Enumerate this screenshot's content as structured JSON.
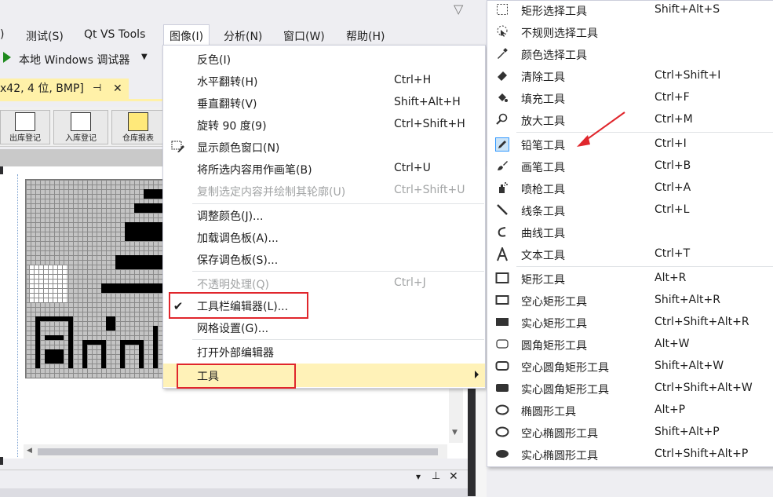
{
  "menubar": {
    "items": [
      {
        "label": ")"
      },
      {
        "label": "测试(S)"
      },
      {
        "label": "Qt VS Tools"
      },
      {
        "label": "图像(I)"
      },
      {
        "label": "分析(N)"
      },
      {
        "label": "窗口(W)"
      },
      {
        "label": "帮助(H)"
      }
    ]
  },
  "toolbar": {
    "debugger_label": "本地 Windows 调试器"
  },
  "document_tab": {
    "title": "x42, 4 位, BMP]"
  },
  "app_toolbar": {
    "buttons": [
      {
        "label": "出库登记"
      },
      {
        "label": "入库登记"
      },
      {
        "label": "仓库报表"
      }
    ]
  },
  "image_menu": {
    "items": [
      {
        "label": "反色(I)",
        "shortcut": ""
      },
      {
        "label": "水平翻转(H)",
        "shortcut": "Ctrl+H"
      },
      {
        "label": "垂直翻转(V)",
        "shortcut": "Shift+Alt+H"
      },
      {
        "label": "旋转 90 度(9)",
        "shortcut": "Ctrl+Shift+H"
      },
      {
        "label": "显示颜色窗口(N)",
        "shortcut": ""
      },
      {
        "label": "将所选内容用作画笔(B)",
        "shortcut": "Ctrl+U"
      },
      {
        "label": "复制选定内容并绘制其轮廓(U)",
        "shortcut": "Ctrl+Shift+U"
      },
      {
        "label": "调整颜色(J)...",
        "shortcut": ""
      },
      {
        "label": "加载调色板(A)...",
        "shortcut": ""
      },
      {
        "label": "保存调色板(S)...",
        "shortcut": ""
      },
      {
        "label": "不透明处理(Q)",
        "shortcut": "Ctrl+J"
      },
      {
        "label": "工具栏编辑器(L)...",
        "shortcut": ""
      },
      {
        "label": "网格设置(G)...",
        "shortcut": ""
      },
      {
        "label": "打开外部编辑器",
        "shortcut": ""
      },
      {
        "label": "工具",
        "shortcut": ""
      }
    ]
  },
  "tools_menu": {
    "items": [
      {
        "label": "矩形选择工具",
        "shortcut": "Shift+Alt+S",
        "icon": "dashed-rect-icon"
      },
      {
        "label": "不规则选择工具",
        "shortcut": "",
        "icon": "lasso-icon"
      },
      {
        "label": "颜色选择工具",
        "shortcut": "",
        "icon": "eyedropper-icon"
      },
      {
        "label": "清除工具",
        "shortcut": "Ctrl+Shift+I",
        "icon": "eraser-icon"
      },
      {
        "label": "填充工具",
        "shortcut": "Ctrl+F",
        "icon": "fill-bucket-icon"
      },
      {
        "label": "放大工具",
        "shortcut": "Ctrl+M",
        "icon": "magnifier-icon"
      },
      {
        "label": "铅笔工具",
        "shortcut": "Ctrl+I",
        "icon": "pencil-icon"
      },
      {
        "label": "画笔工具",
        "shortcut": "Ctrl+B",
        "icon": "brush-icon"
      },
      {
        "label": "喷枪工具",
        "shortcut": "Ctrl+A",
        "icon": "airbrush-icon"
      },
      {
        "label": "线条工具",
        "shortcut": "Ctrl+L",
        "icon": "line-icon"
      },
      {
        "label": "曲线工具",
        "shortcut": "",
        "icon": "curve-icon"
      },
      {
        "label": "文本工具",
        "shortcut": "Ctrl+T",
        "icon": "text-icon"
      },
      {
        "label": "矩形工具",
        "shortcut": "Alt+R",
        "icon": "rectangle-icon"
      },
      {
        "label": "空心矩形工具",
        "shortcut": "Shift+Alt+R",
        "icon": "hollow-rectangle-icon"
      },
      {
        "label": "实心矩形工具",
        "shortcut": "Ctrl+Shift+Alt+R",
        "icon": "filled-rectangle-icon"
      },
      {
        "label": "圆角矩形工具",
        "shortcut": "Alt+W",
        "icon": "rounded-rectangle-icon"
      },
      {
        "label": "空心圆角矩形工具",
        "shortcut": "Shift+Alt+W",
        "icon": "hollow-rounded-rectangle-icon"
      },
      {
        "label": "实心圆角矩形工具",
        "shortcut": "Ctrl+Shift+Alt+W",
        "icon": "filled-rounded-rectangle-icon"
      },
      {
        "label": "椭圆形工具",
        "shortcut": "Alt+P",
        "icon": "ellipse-icon"
      },
      {
        "label": "空心椭圆形工具",
        "shortcut": "Shift+Alt+P",
        "icon": "hollow-ellipse-icon"
      },
      {
        "label": "实心椭圆形工具",
        "shortcut": "Ctrl+Shift+Alt+P",
        "icon": "filled-ellipse-icon"
      }
    ]
  },
  "colors": {
    "highlight_box": "#e0262c",
    "annotation_arrow": "#e0262c",
    "submenu_hover": "#fff2b8",
    "tab_active": "#fff1a8",
    "run_green": "#1e8a1e"
  }
}
